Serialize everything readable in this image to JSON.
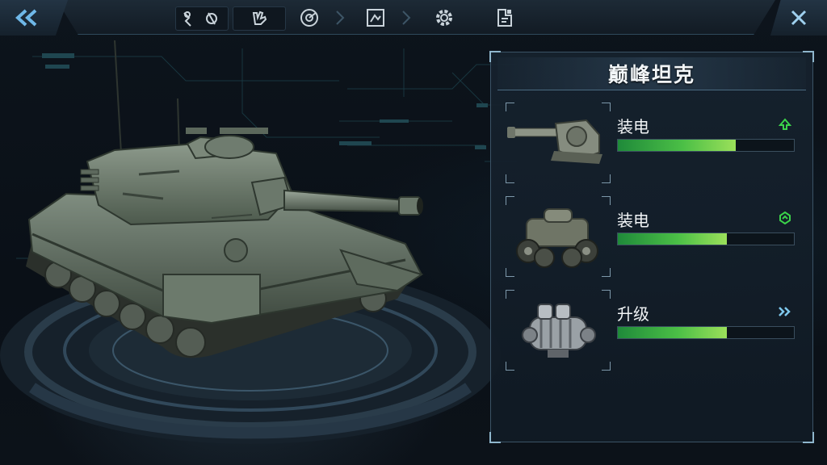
{
  "topbar": {
    "back_icon": "double-chevron-left-icon",
    "close_icon": "close-icon",
    "tools": [
      {
        "name": "repair-tools-icon"
      },
      {
        "name": "glove-icon"
      },
      {
        "name": "radar-icon"
      },
      {
        "name": "map-icon"
      },
      {
        "name": "gear-icon"
      },
      {
        "name": "blueprint-icon"
      }
    ],
    "accent": "#6fb8e8"
  },
  "panel": {
    "title": "巅峰坦克",
    "parts": [
      {
        "label": "装电",
        "image": "cannon-turret",
        "status_icon": "arrow-up-icon",
        "status_color": "#3bd24a",
        "progress": 0.67
      },
      {
        "label": "装电",
        "image": "engine-chassis",
        "status_icon": "hex-up-icon",
        "status_color": "#3bd24a",
        "progress": 0.62
      },
      {
        "label": "升级",
        "image": "engine-block",
        "status_icon": "double-chevron-right-icon",
        "status_color": "#7fc8ee",
        "progress": 0.62
      }
    ]
  }
}
